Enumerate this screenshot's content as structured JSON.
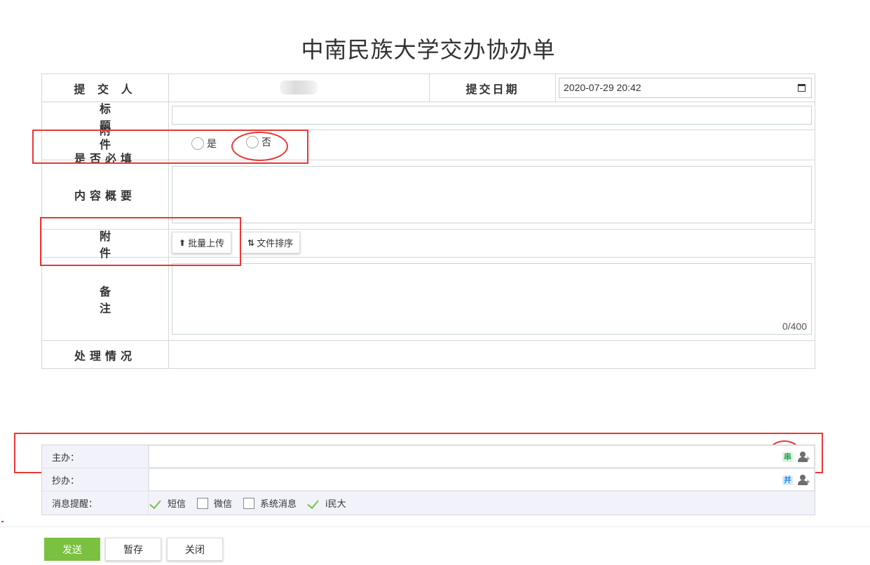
{
  "page": {
    "title": "中南民族大学交办协办单"
  },
  "form": {
    "submitter_label": "提 交 人",
    "date_label": "提交日期",
    "date_value": "2020-07-29 20:42",
    "title_label": "标 题",
    "attachment_required_label_line1": "附 件",
    "attachment_required_label_line2": "是否必填",
    "radio_yes": "是",
    "radio_no": "否",
    "summary_label": "内容概要",
    "attachment_label": "附 件",
    "batch_upload_button": "批量上传",
    "file_sort_button": "文件排序",
    "remark_label": "备 注",
    "remark_counter": "0/400",
    "handling_label": "处理情况"
  },
  "routing": {
    "main_label": "主办：",
    "copy_label": "抄办：",
    "notify_label": "消息提醒：",
    "serial_icon_text": "串",
    "parallel_icon_text": "并",
    "notify_options": [
      {
        "label": "短信",
        "checked": true
      },
      {
        "label": "微信",
        "checked": false
      },
      {
        "label": "系统消息",
        "checked": false
      },
      {
        "label": "i民大",
        "checked": true
      }
    ]
  },
  "footer": {
    "send_button": "发送",
    "save_button": "暂存",
    "close_button": "关闭"
  },
  "colors": {
    "accent_green": "#7ac142",
    "annotation_red": "#e53935",
    "routing_bg": "#f1f2fa"
  }
}
